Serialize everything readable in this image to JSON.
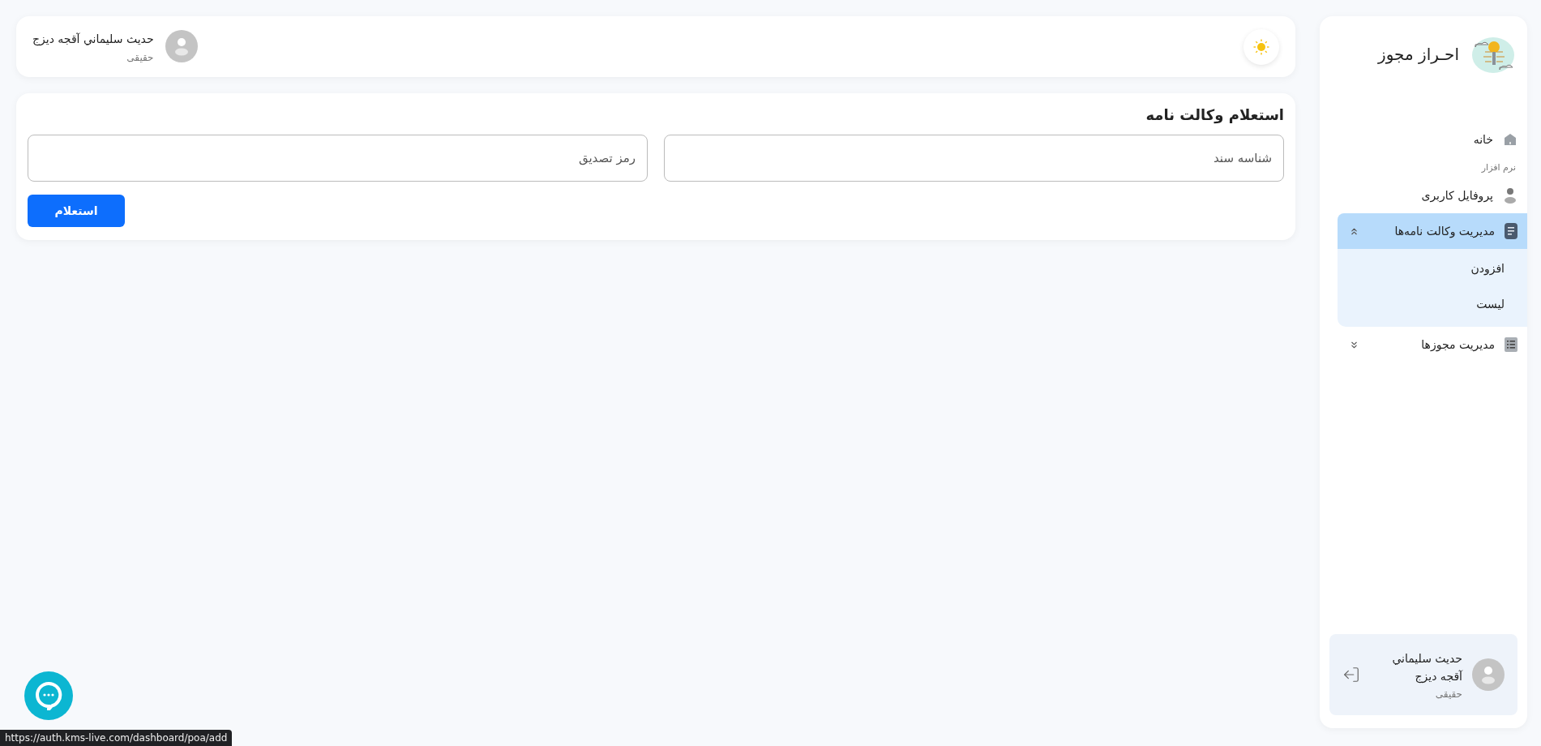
{
  "header": {
    "user": {
      "name": "حديث سليماني آقجه ديزج",
      "role": "حقیقی"
    }
  },
  "form": {
    "title": "استعلام وکالت نامه",
    "fields": [
      {
        "placeholder": "شناسه سند"
      },
      {
        "placeholder": "رمز تصدیق"
      }
    ],
    "submit": "استعلام"
  },
  "sidebar": {
    "brand": "احـراز مجوز",
    "items": [
      {
        "kind": "link",
        "label": "خانه",
        "selected": false
      },
      {
        "kind": "section",
        "label": "نرم افزار"
      },
      {
        "kind": "link",
        "label": "پروفایل کاربری",
        "selected": false
      },
      {
        "kind": "group",
        "label": "مدیریت وکالت نامه‌ها",
        "selected": true,
        "expanded": true,
        "children": [
          {
            "label": "افزودن",
            "selected": false
          },
          {
            "label": "لیست",
            "selected": false
          }
        ]
      },
      {
        "kind": "group",
        "label": "مدیریت مجوزها",
        "selected": false,
        "expanded": false
      }
    ],
    "user": {
      "name": "حديث سليماني آقجه دیزج",
      "role": "حقیقی"
    }
  },
  "status_url": "https://auth.kms-live.com/dashboard/poa/add"
}
